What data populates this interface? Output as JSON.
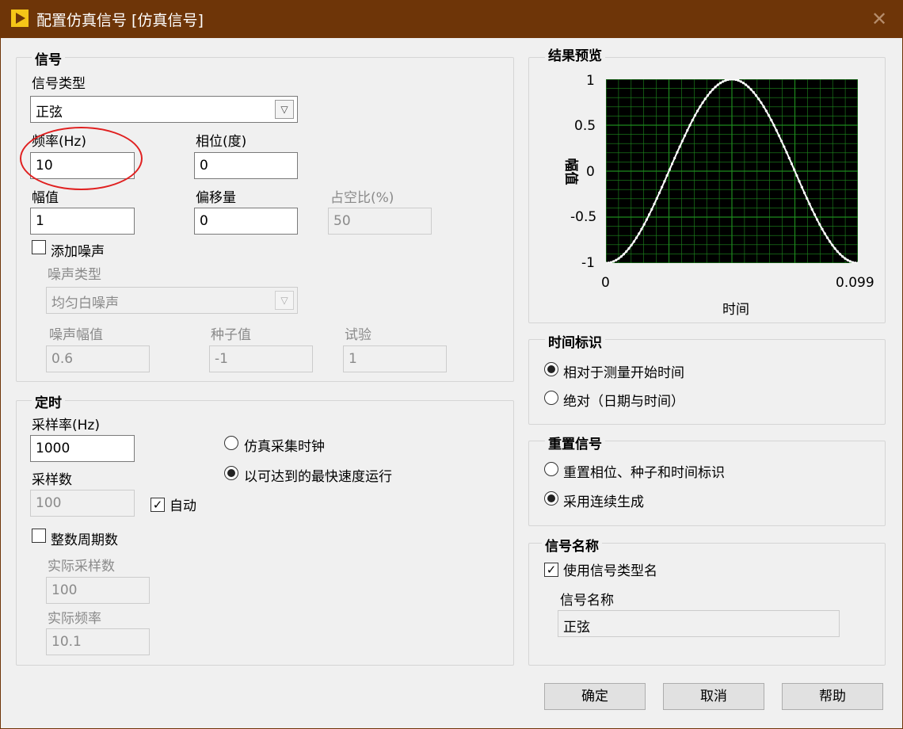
{
  "window": {
    "title": "配置仿真信号 [仿真信号]",
    "close_glyph": "✕"
  },
  "signal": {
    "legend": "信号",
    "type_label": "信号类型",
    "type_value": "正弦",
    "frequency_label": "频率(Hz)",
    "frequency_value": "10",
    "phase_label": "相位(度)",
    "phase_value": "0",
    "amplitude_label": "幅值",
    "amplitude_value": "1",
    "offset_label": "偏移量",
    "offset_value": "0",
    "duty_label": "占空比(%)",
    "duty_value": "50",
    "add_noise_label": "添加噪声",
    "add_noise_checked": false,
    "noise_type_label": "噪声类型",
    "noise_type_value": "均匀白噪声",
    "noise_amplitude_label": "噪声幅值",
    "noise_amplitude_value": "0.6",
    "seed_label": "种子值",
    "seed_value": "-1",
    "trial_label": "试验",
    "trial_value": "1"
  },
  "timing": {
    "legend": "定时",
    "sample_rate_label": "采样率(Hz)",
    "sample_rate_value": "1000",
    "samples_label": "采样数",
    "samples_value": "100",
    "auto_label": "自动",
    "auto_checked": true,
    "integer_cycles_label": "整数周期数",
    "integer_cycles_checked": false,
    "actual_samples_label": "实际采样数",
    "actual_samples_value": "100",
    "actual_freq_label": "实际频率",
    "actual_freq_value": "10.1",
    "radio_sim_clock": "仿真采集时钟",
    "radio_fastest": "以可达到的最快速度运行",
    "selected": "fastest"
  },
  "preview": {
    "legend": "结果预览",
    "y_axis_label": "幅值",
    "x_axis_label": "时间",
    "y_ticks": [
      "1",
      "0.5",
      "0",
      "-0.5",
      "-1"
    ],
    "x_ticks": [
      "0",
      "0.099"
    ]
  },
  "chart_data": {
    "type": "line",
    "xlabel": "时间",
    "ylabel": "幅值",
    "xlim": [
      0,
      0.099
    ],
    "ylim": [
      -1,
      1
    ],
    "grid": true,
    "series": [
      {
        "description": "one period of the selected waveform, -1 at both ends, 1 at the middle",
        "samples": 100
      }
    ],
    "colors": {
      "background": "#000000",
      "grid": "#1e8a1e",
      "line": "#ffffff"
    }
  },
  "time_stamp": {
    "legend": "时间标识",
    "opt_relative": "相对于测量开始时间",
    "opt_absolute": "绝对（日期与时间）",
    "selected": "relative"
  },
  "reset_signal": {
    "legend": "重置信号",
    "opt_reset": "重置相位、种子和时间标识",
    "opt_continuous": "采用连续生成",
    "selected": "continuous"
  },
  "signal_name": {
    "legend": "信号名称",
    "use_type_name_label": "使用信号类型名",
    "use_type_name_checked": true,
    "name_label": "信号名称",
    "name_value": "正弦"
  },
  "buttons": {
    "ok": "确定",
    "cancel": "取消",
    "help": "帮助"
  },
  "colors": {
    "titlebar": "#6e3508",
    "annotation": "#e02020"
  }
}
